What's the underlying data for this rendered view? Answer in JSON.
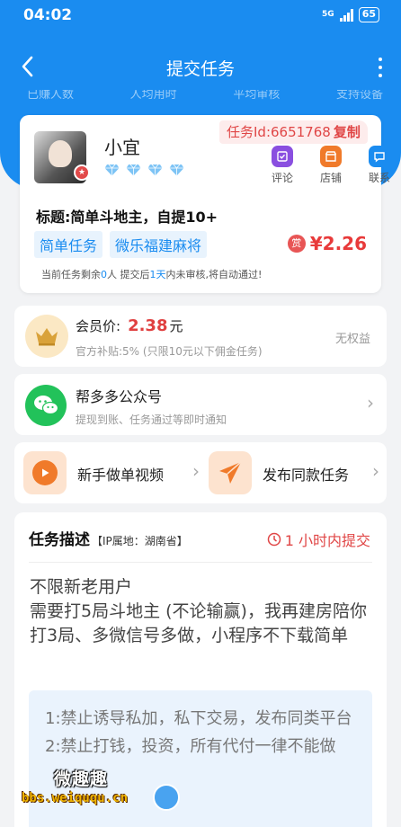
{
  "status_bar": {
    "time": "04:02",
    "network": "5G",
    "battery": "65"
  },
  "nav": {
    "title": "提交任务"
  },
  "header_stats": [
    "已赚人数",
    "人均用时",
    "平均审核",
    "支持设备"
  ],
  "task": {
    "user_name": "小宜",
    "badge": "★",
    "task_id_label": "任务Id:6651768",
    "copy_label": "复制",
    "actions": [
      {
        "label": "评论",
        "color": "#8a4fe0"
      },
      {
        "label": "店铺",
        "color": "#f07a2a"
      },
      {
        "label": "联系",
        "color": "#1a8cf0"
      }
    ],
    "title": "标题:简单斗地主，自提10+",
    "tags": [
      "简单任务",
      "微乐福建麻将"
    ],
    "reward_icon": "赏",
    "reward": "¥2.26",
    "note_a": "当前任务剩余",
    "note_remaining": "0",
    "note_b": "人  提交后",
    "note_days": "1天",
    "note_c": "内未审核,将自动通过!"
  },
  "vip": {
    "label": "会员价:",
    "price": "2.38",
    "unit": "元",
    "subsidy": "官方补贴:5% (只限10元以下佣金任务)",
    "status": "无权益"
  },
  "wechat": {
    "title": "帮多多公众号",
    "subtitle": "提现到账、任务通过等即时通知"
  },
  "links": {
    "video": "新手做单视频",
    "publish": "发布同款任务"
  },
  "description": {
    "heading": "任务描述",
    "ip": "【IP属地：湖南省】",
    "time_limit": "1 小时内提交",
    "body": "不限新老用户\n需要打5局斗地主 (不论输赢)，我再建房陪你打3局、多微信号多做，小程序不下载简单",
    "rules": "1:禁止诱导私加，私下交易，发布同类平台\n2:禁止打钱，投资，所有代付一律不能做"
  },
  "watermark": {
    "top": "微趣趣",
    "bottom": "bbs.weiququ.cn"
  }
}
